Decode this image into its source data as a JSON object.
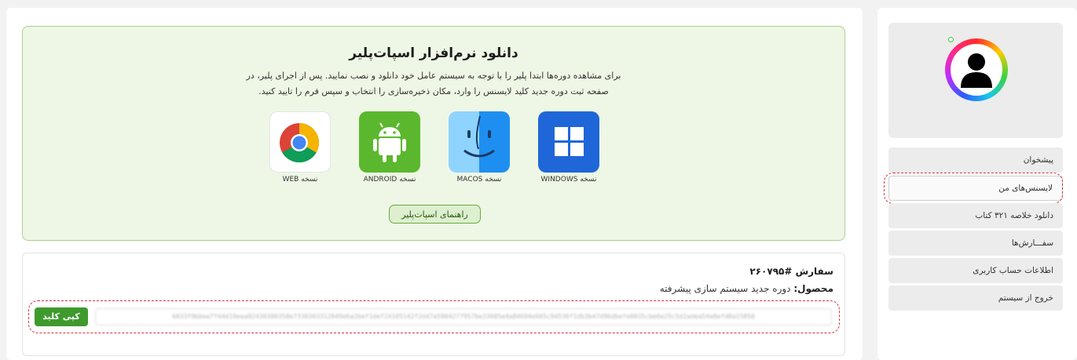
{
  "download": {
    "title": "دانلود نرم‌افزار اسپات‌پلیر",
    "line1": "برای مشاهده دوره‌ها ابتدا پلیر را با توجه به سیستم عامل خود دانلود و نصب نمایید. پس از اجرای پلیر، در",
    "line2": "صفحه ثبت دوره جدید کلید لایسنس را وارد، مکان ذخیره‌سازی را انتخاب و سپس فرم را تایید کنید.",
    "apps": [
      {
        "label": "نسخه WINDOWS",
        "icon": "windows-icon"
      },
      {
        "label": "نسخه MACOS",
        "icon": "finder-icon"
      },
      {
        "label": "نسخه ANDROID",
        "icon": "android-icon"
      },
      {
        "label": "نسخه WEB",
        "icon": "chrome-icon"
      }
    ],
    "guide_button": "راهنمای اسپات‌پلیر"
  },
  "order": {
    "number": "سفارش #۲۶۰۷۹۵",
    "product_label": "محصول:",
    "product_name": "دوره جدید سیستم سازی پیشرفته",
    "license_key": "6033f9bbee7f44d19eea92430300358e7330303312049e6a2bef1def24105142f2d47a5904277957be33605e4a84694e665c94536f1db3b47d96dbefe0035cbe6e25c5d2adea54a0efd0a15850",
    "copy_button": "کپی کلید"
  },
  "sidebar": {
    "items": [
      {
        "label": "پیشخوان",
        "active": false
      },
      {
        "label": "لایسنس‌های من",
        "active": true
      },
      {
        "label": "دانلود خلاصه ۳۲۱ کتاب",
        "active": false
      },
      {
        "label": "سفـــارش‌ها",
        "active": false
      },
      {
        "label": "اطلاعات حساب کاربری",
        "active": false
      },
      {
        "label": "خروج از سیستم",
        "active": false
      }
    ]
  },
  "colors": {
    "accent_green": "#3f9a2d",
    "highlight_red": "#d6333a",
    "download_bg": "#eef7e6"
  }
}
